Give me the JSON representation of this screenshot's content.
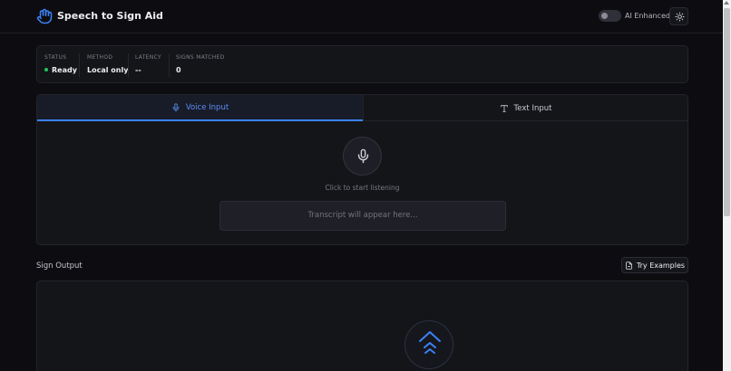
{
  "header": {
    "title": "Speech to Sign Aid",
    "ai_toggle_label": "AI Enhanced",
    "ai_enabled": false,
    "logo_icon": "hand-icon",
    "theme_icon": "sun-icon"
  },
  "status": {
    "items": [
      {
        "label": "STATUS",
        "value": "Ready"
      },
      {
        "label": "METHOD",
        "value": "Local only"
      },
      {
        "label": "LATENCY",
        "value": "--"
      },
      {
        "label": "SIGNS MATCHED",
        "value": "0"
      }
    ],
    "ready_color": "#22c55e"
  },
  "input": {
    "tabs": [
      {
        "label": "Voice Input",
        "icon": "microphone-icon",
        "active": true
      },
      {
        "label": "Text Input",
        "icon": "text-icon",
        "active": false
      }
    ],
    "listen_hint": "Click to start listening",
    "transcript_placeholder": "Transcript will appear here..."
  },
  "output": {
    "title": "Sign Output",
    "examples_button": "Try Examples",
    "placeholder_icon": "double-chevron-up-icon"
  },
  "colors": {
    "accent": "#3b82f6",
    "background": "#0d0d11",
    "card": "#141519"
  }
}
